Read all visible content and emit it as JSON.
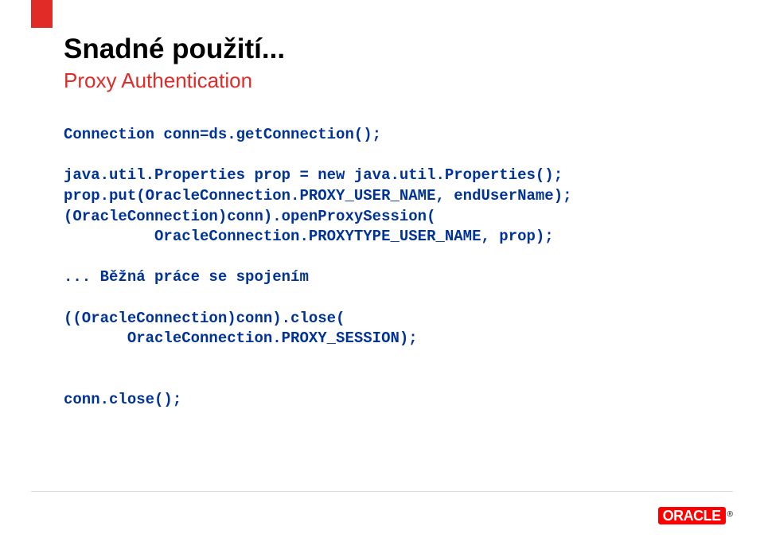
{
  "slide": {
    "title": "Snadné použití...",
    "subtitle": "Proxy Authentication",
    "code": "Connection conn=ds.getConnection();\n\njava.util.Properties prop = new java.util.Properties();\nprop.put(OracleConnection.PROXY_USER_NAME, endUserName);\n(OracleConnection)conn).openProxySession(\n          OracleConnection.PROXYTYPE_USER_NAME, prop);\n\n... Běžná práce se spojením\n\n((OracleConnection)conn).close(\n       OracleConnection.PROXY_SESSION);\n\n\nconn.close();"
  },
  "logo": {
    "text": "ORACLE",
    "reg": "®"
  }
}
